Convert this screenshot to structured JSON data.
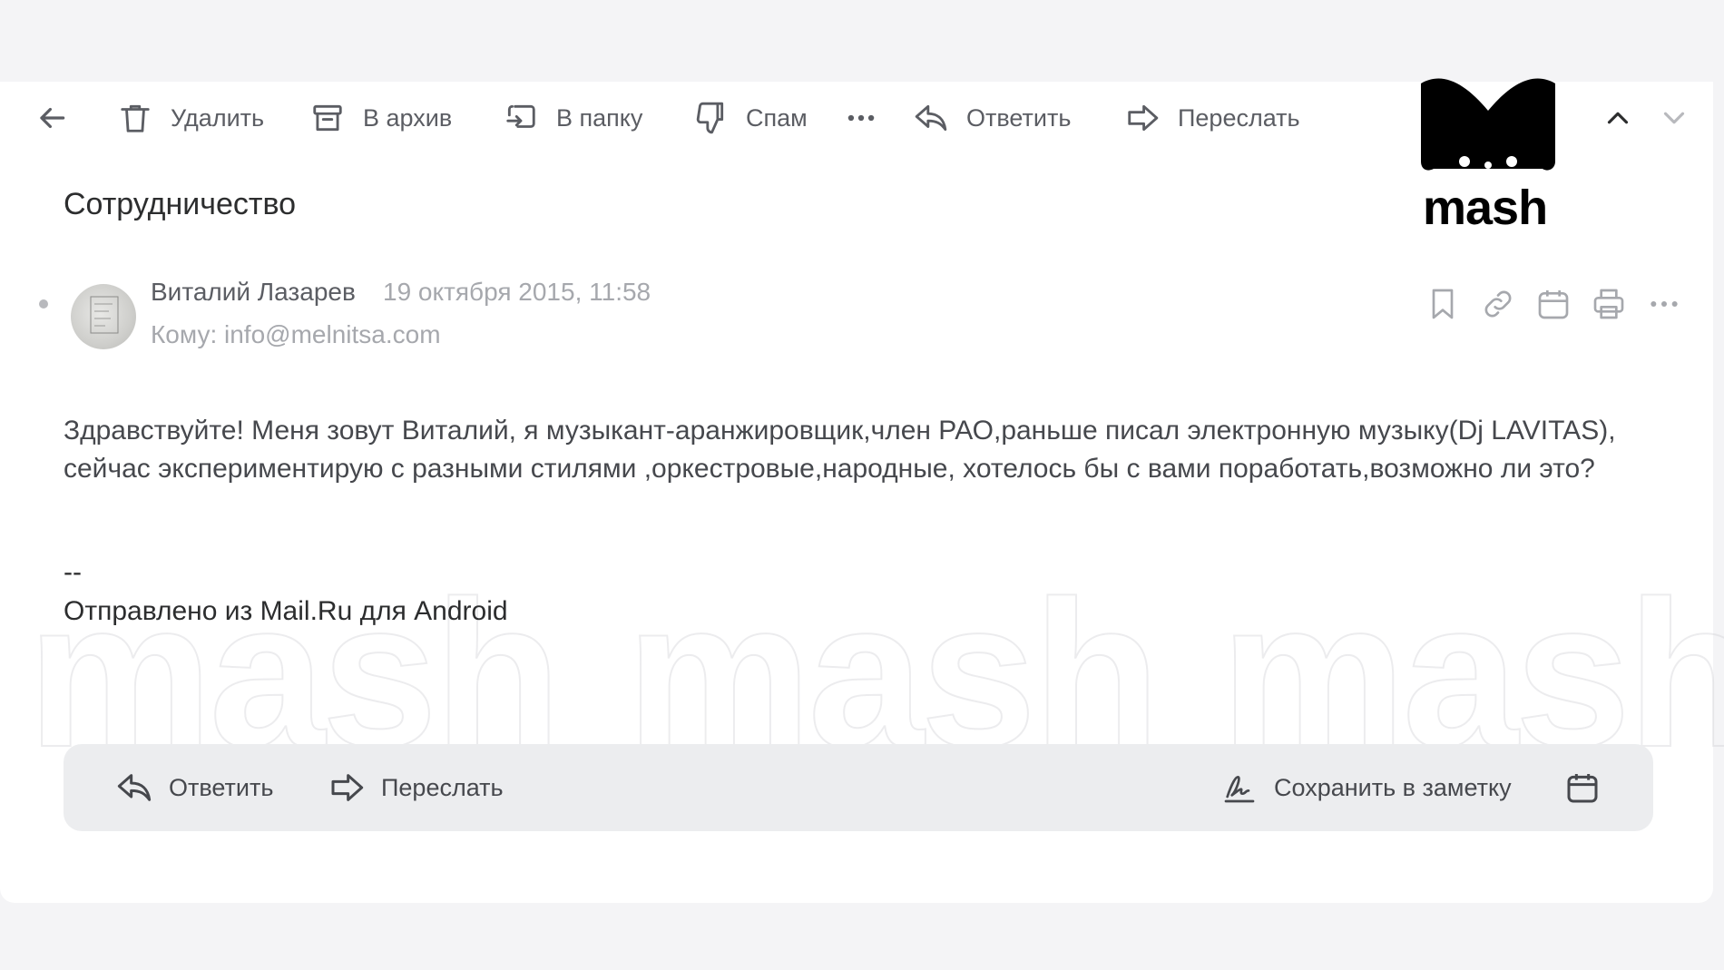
{
  "toolbar": {
    "delete_label": "Удалить",
    "archive_label": "В архив",
    "move_label": "В папку",
    "spam_label": "Спам",
    "reply_label": "Ответить",
    "forward_label": "Переслать"
  },
  "logo": {
    "text": "mash"
  },
  "message": {
    "subject": "Сотрудничество",
    "sender_name": "Виталий Лазарев",
    "date": "19 октября 2015, 11:58",
    "to": "Кому: info@melnitsa.com",
    "body": "Здравствуйте! Меня зовут Виталий, я музыкант-аранжировщик,член РАО,раньше писал электронную музыку(Dj LAVITAS), сейчас экспериментирую с разными стилями ,оркестровые,народные, хотелось бы с вами поработать,возможно ли это?",
    "signature_separator": "--",
    "signature": "Отправлено из Mail.Ru для Android"
  },
  "bottom_bar": {
    "reply_label": "Ответить",
    "forward_label": "Переслать",
    "save_note_label": "Сохранить в заметку"
  },
  "watermark": {
    "text": "mash"
  },
  "colors": {
    "icon": "#5b5d63",
    "muted": "#a6a8ad",
    "bar": "#ecedef"
  }
}
